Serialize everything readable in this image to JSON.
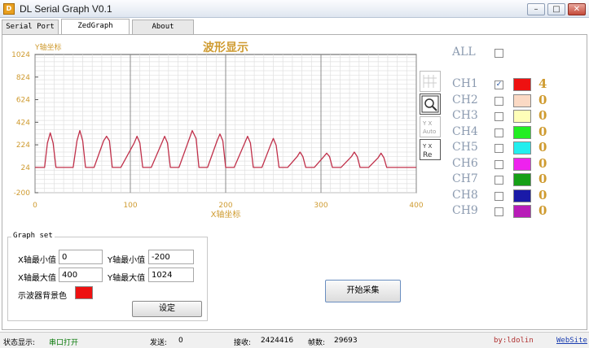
{
  "window": {
    "title": "DL Serial Graph V0.1",
    "icon": "app-icon",
    "buttons": {
      "minimize": "–",
      "maximize": "□",
      "close": "✕"
    }
  },
  "tabs": [
    {
      "label": "Serial Port",
      "active": false
    },
    {
      "label": "ZedGraph",
      "active": true
    },
    {
      "label": "About",
      "active": false
    }
  ],
  "graph": {
    "bg_color": "#ffffff",
    "line_color": "#c0304a",
    "axis_label_color": "#cf9b30"
  },
  "chart_data": {
    "type": "line",
    "title": "波形显示",
    "xlabel": "X轴坐标",
    "ylabel": "Y轴坐标",
    "xlim": [
      0,
      400
    ],
    "ylim": [
      -200,
      1024
    ],
    "x_ticks": [
      "0",
      "100",
      "200",
      "300",
      "400"
    ],
    "y_ticks": [
      "1024",
      "824",
      "624",
      "424",
      "224",
      "24",
      "-200"
    ],
    "grid": true,
    "series": [
      {
        "color": "#c0304a",
        "x": [
          0,
          10,
          13,
          16,
          19,
          22,
          28,
          40,
          44,
          47,
          50,
          53,
          56,
          62,
          72,
          75,
          78,
          81,
          84,
          90,
          104,
          107,
          110,
          113,
          116,
          122,
          133,
          136,
          139,
          142,
          145,
          151,
          162,
          165,
          169,
          172,
          175,
          181,
          191,
          194,
          197,
          200,
          203,
          209,
          220,
          223,
          226,
          229,
          232,
          238,
          247,
          250,
          253,
          256,
          259,
          265,
          275,
          278,
          281,
          284,
          287,
          293,
          303,
          306,
          309,
          312,
          315,
          321,
          332,
          335,
          338,
          341,
          344,
          350,
          360,
          363,
          366,
          369,
          372,
          378,
          400
        ],
        "y": [
          24,
          24,
          240,
          330,
          240,
          24,
          24,
          24,
          260,
          350,
          260,
          24,
          24,
          24,
          260,
          300,
          260,
          24,
          24,
          24,
          240,
          300,
          240,
          24,
          24,
          24,
          240,
          300,
          240,
          24,
          24,
          24,
          280,
          350,
          280,
          24,
          24,
          24,
          260,
          320,
          260,
          24,
          24,
          24,
          240,
          300,
          240,
          24,
          24,
          24,
          220,
          280,
          220,
          24,
          24,
          24,
          120,
          160,
          120,
          24,
          24,
          24,
          120,
          150,
          120,
          24,
          24,
          24,
          120,
          160,
          120,
          24,
          24,
          24,
          110,
          150,
          110,
          24,
          24,
          24,
          24
        ]
      }
    ]
  },
  "channels": {
    "all_label": "ALL",
    "items": [
      {
        "name": "CH1",
        "checked": true,
        "color": "#ee1111",
        "count": "4"
      },
      {
        "name": "CH2",
        "checked": false,
        "color": "#fbd9c4",
        "count": "0"
      },
      {
        "name": "CH3",
        "checked": false,
        "color": "#fefeb8",
        "count": "0"
      },
      {
        "name": "CH4",
        "checked": false,
        "color": "#22ee22",
        "count": "0"
      },
      {
        "name": "CH5",
        "checked": false,
        "color": "#22eeee",
        "count": "0"
      },
      {
        "name": "CH6",
        "checked": false,
        "color": "#ee22ee",
        "count": "0"
      },
      {
        "name": "CH7",
        "checked": false,
        "color": "#16a016",
        "count": "0"
      },
      {
        "name": "CH8",
        "checked": false,
        "color": "#1a1aa8",
        "count": "0"
      },
      {
        "name": "CH9",
        "checked": false,
        "color": "#b81cb8",
        "count": "0"
      }
    ]
  },
  "graph_set": {
    "title": "Graph set",
    "x_min_label": "X轴最小值",
    "x_min": "0",
    "x_max_label": "X轴最大值",
    "x_max": "400",
    "y_min_label": "Y轴最小值",
    "y_min": "-200",
    "y_max_label": "Y轴最大值",
    "y_max": "1024",
    "bg_label": "示波器背景色",
    "set_button": "设定"
  },
  "start_button": "开始采集",
  "status": {
    "state_label": "状态显示:",
    "state_value": "串口打开",
    "send_label": "发送:",
    "send_value": "0",
    "recv_label": "接收:",
    "recv_value": "2424416",
    "frames_label": "帧数:",
    "frames_value": "29693",
    "author": "by:ldolin",
    "website": "WebSite"
  }
}
